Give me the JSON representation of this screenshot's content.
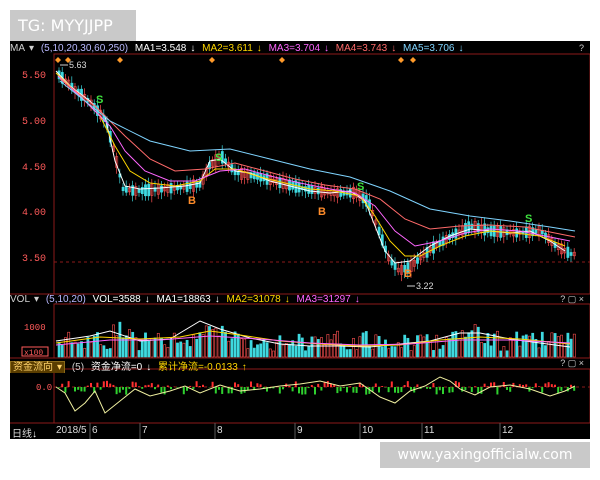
{
  "header_label": "TG: MYYJJPP",
  "watermark": "www.yaxingofficialw.com",
  "price_panel": {
    "indicator_name": "MA",
    "params": "(5,10,20,30,60,250)",
    "ma": [
      {
        "label": "MA1=3.548",
        "color": "#ffffff"
      },
      {
        "label": "MA2=3.611",
        "color": "#ffd700"
      },
      {
        "label": "MA3=3.704",
        "color": "#ff66ff"
      },
      {
        "label": "MA4=3.743",
        "color": "#ff6a6a"
      },
      {
        "label": "MA5=3.706",
        "color": "#7fd4ff"
      }
    ],
    "y_ticks": [
      "5.50",
      "5.00",
      "4.50",
      "4.00",
      "3.50"
    ],
    "high_label": "5.63",
    "low_label": "3.22",
    "signals": [
      {
        "letter": "S",
        "color": "#3ee03e"
      },
      {
        "letter": "S",
        "color": "#3ee03e"
      },
      {
        "letter": "S",
        "color": "#3ee03e"
      },
      {
        "letter": "S",
        "color": "#3ee03e"
      },
      {
        "letter": "B",
        "color": "#ff8c2a"
      },
      {
        "letter": "B",
        "color": "#ff8c2a"
      },
      {
        "letter": "B",
        "color": "#ff8c2a"
      }
    ]
  },
  "volume_panel": {
    "indicator_name": "VOL",
    "params": "(5,10,20)",
    "vol_label": "VOL=3588",
    "ma": [
      {
        "label": "MA1=18863",
        "color": "#ffffff"
      },
      {
        "label": "MA2=31078",
        "color": "#ffd700"
      },
      {
        "label": "MA3=31297",
        "color": "#ff66ff"
      }
    ],
    "y_tick": "1000",
    "unit_label": "x100"
  },
  "fund_panel": {
    "button_label": "资金流向",
    "params": "(5)",
    "net_label": "资金净流=0",
    "cum_label": "累计净流=-0.0133",
    "y_tick": "0.0"
  },
  "x_axis": {
    "period_button": "日线",
    "dates": [
      "2018/5",
      "6",
      "7",
      "8",
      "9",
      "10",
      "11",
      "12"
    ]
  },
  "colors": {
    "up": "#ff5050",
    "down": "#3fd9e0",
    "background": "#000000"
  }
}
